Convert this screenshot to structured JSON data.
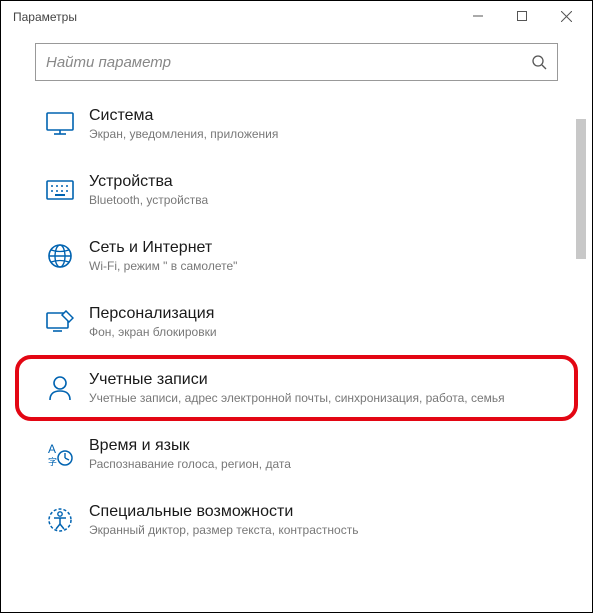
{
  "window": {
    "title": "Параметры"
  },
  "search": {
    "placeholder": "Найти параметр"
  },
  "categories": [
    {
      "title": "Система",
      "desc": "Экран, уведомления, приложения"
    },
    {
      "title": "Устройства",
      "desc": "Bluetooth, устройства"
    },
    {
      "title": "Сеть и Интернет",
      "desc": "Wi-Fi, режим \" в самолете\""
    },
    {
      "title": "Персонализация",
      "desc": "Фон, экран блокировки"
    },
    {
      "title": "Учетные записи",
      "desc": "Учетные записи, адрес электронной почты, синхронизация, работа, семья"
    },
    {
      "title": "Время и язык",
      "desc": "Распознавание голоса, регион, дата"
    },
    {
      "title": "Специальные возможности",
      "desc": "Экранный диктор, размер текста, контрастность"
    }
  ]
}
